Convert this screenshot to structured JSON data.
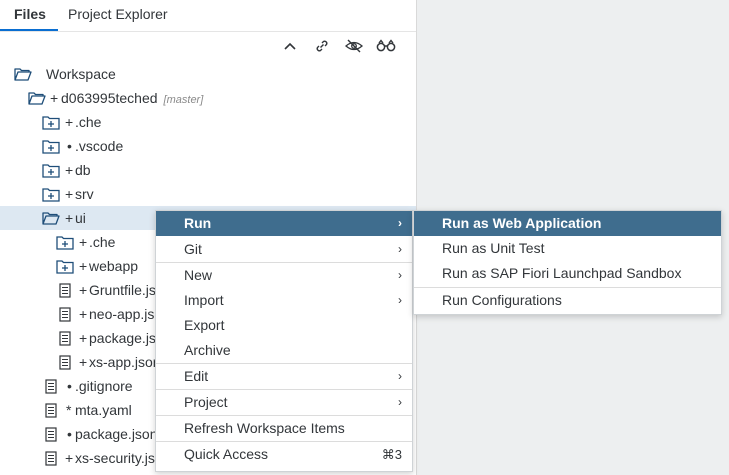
{
  "tabs": {
    "files": "Files",
    "project_explorer": "Project Explorer"
  },
  "toolbar": {
    "icons": [
      "collapse-icon",
      "link-icon",
      "hide-icon",
      "binoculars-icon"
    ]
  },
  "tree": {
    "workspace": {
      "label": "Workspace"
    },
    "project": {
      "mark": "+",
      "label": "d063995teched",
      "branch": "[master]"
    },
    "che": {
      "mark": "+",
      "label": ".che"
    },
    "vscode": {
      "mark": "•",
      "label": ".vscode"
    },
    "db": {
      "mark": "+",
      "label": "db"
    },
    "srv": {
      "mark": "+",
      "label": "srv"
    },
    "ui": {
      "mark": "+",
      "label": "ui"
    },
    "ui_che": {
      "mark": "+",
      "label": ".che"
    },
    "webapp": {
      "mark": "+",
      "label": "webapp"
    },
    "gruntfile": {
      "mark": "+",
      "label": "Gruntfile.js"
    },
    "neo_app": {
      "mark": "+",
      "label": "neo-app.json"
    },
    "package_ui": {
      "mark": "+",
      "label": "package.json"
    },
    "xs_app": {
      "mark": "+",
      "label": "xs-app.json"
    },
    "gitignore": {
      "mark": "•",
      "label": ".gitignore"
    },
    "mta": {
      "mark": "*",
      "label": "mta.yaml"
    },
    "package_root": {
      "mark": "•",
      "label": "package.json"
    },
    "xs_security": {
      "mark": "+",
      "label": "xs-security.json"
    }
  },
  "context_menu": {
    "run": "Run",
    "git": "Git",
    "new": "New",
    "import": "Import",
    "export": "Export",
    "archive": "Archive",
    "edit": "Edit",
    "project": "Project",
    "refresh": "Refresh Workspace Items",
    "quick_access": "Quick Access",
    "quick_access_shortcut": "⌘3",
    "submenu_arrow": "›"
  },
  "run_submenu": {
    "web_app": "Run as Web Application",
    "unit_test": "Run as Unit Test",
    "fiori_sandbox": "Run as SAP Fiori Launchpad Sandbox",
    "configurations": "Run Configurations"
  },
  "colors": {
    "accent": "#0a6ed1",
    "folder_icon": "#1f4e79",
    "menu_highlight": "#3f6d8e",
    "row_selected": "#dde8f2"
  }
}
